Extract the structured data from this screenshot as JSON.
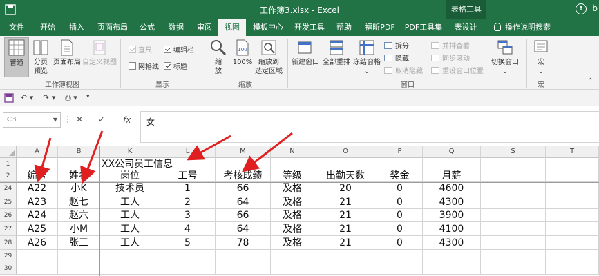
{
  "titlebar": {
    "title": "工作簿3.xlsx  -  Excel",
    "context_tab": "表格工具",
    "user": "b"
  },
  "tabs": [
    "文件",
    "开始",
    "插入",
    "页面布局",
    "公式",
    "数据",
    "审阅",
    "视图",
    "模板中心",
    "开发工具",
    "帮助",
    "福昕PDF",
    "PDF工具集",
    "表设计",
    "操作说明搜索"
  ],
  "active_tab": "视图",
  "ribbon": {
    "group_workbook_views": {
      "label": "工作簿视图",
      "normal": "普通",
      "page_break": [
        "分页",
        "预览"
      ],
      "page_layout": "页面布局",
      "custom_views": "自定义视图"
    },
    "group_show": {
      "label": "显示",
      "ruler": "直尺",
      "formula_bar": "编辑栏",
      "gridlines": "网格线",
      "headings": "标题"
    },
    "group_zoom": {
      "label": "缩放",
      "zoom": [
        "缩",
        "放"
      ],
      "zoom_100": "100%",
      "zoom_selection": [
        "缩放到",
        "选定区域"
      ]
    },
    "group_window": {
      "label": "窗口",
      "new_window": "新建窗口",
      "arrange_all": "全部重排",
      "freeze_panes": "冻结窗格",
      "split": "拆分",
      "hide": "隐藏",
      "unhide": "取消隐藏",
      "side_by_side": "并排查看",
      "sync_scroll": "同步滚动",
      "reset_position": "重设窗口位置",
      "switch_windows": "切换窗口"
    },
    "group_macros": {
      "label": "宏",
      "macros": "宏"
    }
  },
  "formula_bar": {
    "name_box": "C3",
    "cancel": "✕",
    "enter": "✓",
    "fx": "fx",
    "content": "女"
  },
  "grid": {
    "columns": [
      "A",
      "B",
      "K",
      "L",
      "M",
      "N",
      "O",
      "P",
      "Q",
      "S",
      "T"
    ],
    "rows": [
      {
        "num": "1",
        "cells": [
          "",
          "",
          "XX公司员工信息",
          "",
          "",
          "",
          "",
          "",
          "",
          "",
          ""
        ]
      },
      {
        "num": "2",
        "cells": [
          "编号",
          "姓名",
          "岗位",
          "工号",
          "考核成绩",
          "等级",
          "出勤天数",
          "奖金",
          "月薪",
          "",
          ""
        ]
      },
      {
        "num": "24",
        "cells": [
          "A22",
          "小K",
          "技术员",
          "1",
          "66",
          "及格",
          "20",
          "0",
          "4600",
          "",
          ""
        ]
      },
      {
        "num": "25",
        "cells": [
          "A23",
          "赵七",
          "工人",
          "2",
          "64",
          "及格",
          "21",
          "0",
          "4300",
          "",
          ""
        ]
      },
      {
        "num": "26",
        "cells": [
          "A24",
          "赵六",
          "工人",
          "3",
          "66",
          "及格",
          "21",
          "0",
          "3900",
          "",
          ""
        ]
      },
      {
        "num": "27",
        "cells": [
          "A25",
          "小M",
          "工人",
          "4",
          "64",
          "及格",
          "21",
          "0",
          "4100",
          "",
          ""
        ]
      },
      {
        "num": "28",
        "cells": [
          "A26",
          "张三",
          "工人",
          "5",
          "78",
          "及格",
          "21",
          "0",
          "4300",
          "",
          ""
        ]
      },
      {
        "num": "29",
        "cells": [
          "",
          "",
          "",
          "",
          "",
          "",
          "",
          "",
          "",
          "",
          ""
        ]
      },
      {
        "num": "30",
        "cells": [
          "",
          "",
          "",
          "",
          "",
          "",
          "",
          "",
          "",
          "",
          ""
        ]
      }
    ]
  },
  "colors": {
    "excel_green": "#217346",
    "annotation_arrow": "#e02020"
  }
}
